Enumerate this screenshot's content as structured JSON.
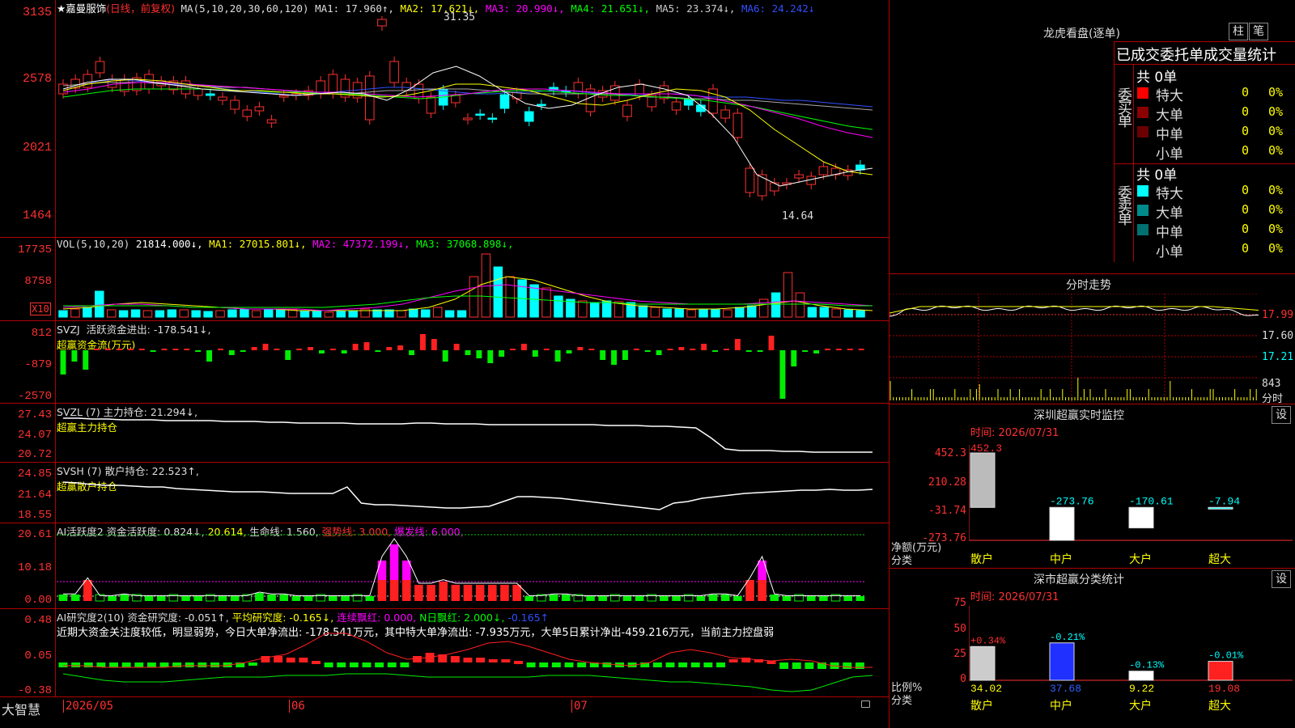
{
  "app": {
    "brand": "大智慧"
  },
  "kline": {
    "stock": "★嘉曼服饰",
    "mode": "(日线，前复权)",
    "ma_label": "MA(5,10,20,30,60,120)",
    "ma": [
      "MA1: 17.960↑,",
      "MA2: 17.621↓,",
      "MA3: 20.990↓,",
      "MA4: 21.651↓,",
      "MA5: 23.374↓,",
      "MA6: 24.242↓"
    ],
    "y_labels": [
      "3135",
      "2578",
      "2021",
      "1464"
    ],
    "high_label": "31.35",
    "low_label": "14.64"
  },
  "vol": {
    "label": "VOL(5,10,20)",
    "value": "21814.000↓,",
    "ma": [
      "MA1: 27015.801↓,",
      "MA2: 47372.199↓,",
      "MA3: 37068.898↓,"
    ],
    "y_labels": [
      "17735",
      "8758"
    ],
    "unit": "X10"
  },
  "svzj": {
    "label": "SVZJ  活跃资金进出: -178.541↓,",
    "sub": "超赢资金流(万元)",
    "y_labels": [
      "812",
      "-879",
      "-2570"
    ]
  },
  "svzl": {
    "label": "SVZL (7) 主力持仓: 21.294↓,",
    "sub": "超赢主力持仓",
    "y_labels": [
      "27.43",
      "24.07",
      "20.72"
    ]
  },
  "svsh": {
    "label": "SVSH (7) 散户持仓: 22.523↑,",
    "sub": "超赢散户持仓",
    "y_labels": [
      "24.85",
      "21.64",
      "18.55"
    ]
  },
  "ai_active": {
    "label": "AI活跃度2 资金活跃度: 0.824↓,",
    "v2": "20.614,",
    "v3": "生命线: 1.560,",
    "v4": "强势线: 3.000,",
    "v5": "爆发线: 6.000,",
    "y_labels": [
      "20.61",
      "10.18",
      "0.00"
    ]
  },
  "ai_research": {
    "label": "AI研究度2(10) 资金研究度: -0.051↑,",
    "v2": "平均研究度: -0.165↓,",
    "v3": "连续飘红: 0.000,",
    "v4": "N日飘红: 2.000↓,",
    "v5": "-0.165↑",
    "comment": "近期大资金关注度较低，明显弱势，今日大单净流出: -178.541万元，其中特大单净流出: -7.935万元，大单5日累计净出-459.216万元，当前主力控盘弱",
    "y_labels": [
      "0.48",
      "0.05",
      "-0.38"
    ]
  },
  "xaxis": {
    "labels": [
      "2026/05",
      "06",
      "07"
    ]
  },
  "longhu": {
    "title": "龙虎看盘(逐单)",
    "btn_bar": "柱",
    "btn_pen": "笔",
    "subtitle": "已成交委托单成交量统计",
    "buy_label": "委买单",
    "sell_label": "委卖单",
    "buy_total": "共 0单",
    "sell_total": "共 0单",
    "buy_rows": [
      {
        "name": "特大",
        "count": "0",
        "pct": "0%",
        "color": "#ff0000"
      },
      {
        "name": "大单",
        "count": "0",
        "pct": "0%",
        "color": "#8b0000"
      },
      {
        "name": "中单",
        "count": "0",
        "pct": "0%",
        "color": "#6b0000"
      },
      {
        "name": "小单",
        "count": "0",
        "pct": "0%",
        "color": ""
      }
    ],
    "sell_rows": [
      {
        "name": "特大",
        "count": "0",
        "pct": "0%",
        "color": "#00ffff"
      },
      {
        "name": "大单",
        "count": "0",
        "pct": "0%",
        "color": "#008b8b"
      },
      {
        "name": "中单",
        "count": "0",
        "pct": "0%",
        "color": "#007070"
      },
      {
        "name": "小单",
        "count": "0",
        "pct": "0%",
        "color": ""
      }
    ]
  },
  "intraday": {
    "title": "分时走势",
    "y_labels": [
      "17.99",
      "17.60",
      "17.21"
    ],
    "vol_label": "843",
    "vol_unit": "分时"
  },
  "monitor": {
    "title": "深圳超赢实时监控",
    "btn": "设",
    "time": "时间: 2026/07/31",
    "y_labels": [
      "452.3",
      "210.28",
      "-31.74",
      "-273.76"
    ],
    "ylabel_1": "净额(万元)",
    "ylabel_2": "分类",
    "categories": [
      "散户",
      "中户",
      "大户",
      "超大"
    ],
    "values": [
      452.3,
      -273.76,
      -170.61,
      -7.94
    ],
    "value_labels": [
      "452.3",
      "-273.76",
      "-170.61",
      "-7.94"
    ]
  },
  "classify": {
    "title": "深市超赢分类统计",
    "btn": "设",
    "time": "时间: 2026/07/31",
    "y_labels": [
      "75",
      "50",
      "25",
      "0"
    ],
    "ylabel_1": "比例%",
    "ylabel_2": "分类",
    "categories": [
      "散户",
      "中户",
      "大户",
      "超大"
    ],
    "values": [
      34.02,
      37.68,
      9.22,
      19.08
    ],
    "value_labels": [
      "34.02",
      "37.68",
      "9.22",
      "19.08"
    ],
    "change_labels": [
      "+0.34%",
      "-0.21%",
      "-0.13%",
      "-0.01%"
    ]
  },
  "colors": {
    "up": "#ff3030",
    "down": "#00ffff",
    "grid": "#b00000"
  }
}
